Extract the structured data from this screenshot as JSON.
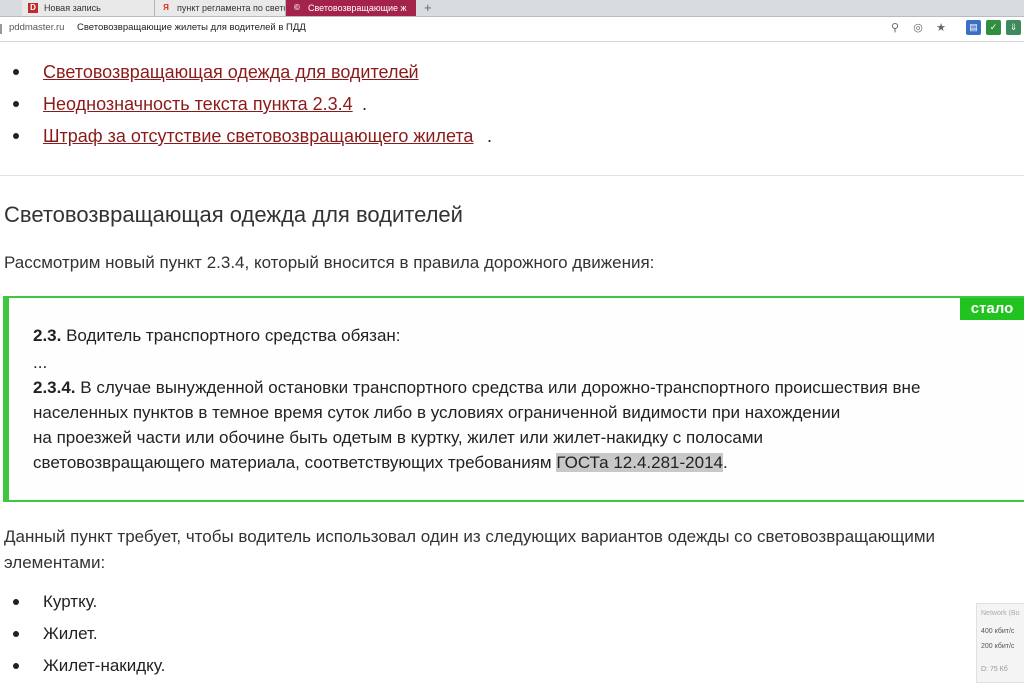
{
  "browser": {
    "tabs": [
      {
        "label": "Новая запись",
        "icon": "D"
      },
      {
        "label": "пункт регламента по свето",
        "icon": "Я"
      },
      {
        "label": "Световозвращающие ж",
        "icon": "©"
      }
    ],
    "new_tab_glyph": "+",
    "domain": "pddmaster.ru",
    "title": "Световозвращающие жилеты для водителей в ПДД"
  },
  "toc": [
    {
      "label": "Световозвращающая одежда для водителей",
      "suffix": "."
    },
    {
      "label": "Неоднозначность текста пункта 2.3.4",
      "suffix": "."
    },
    {
      "label": "Штраф за отсутствие световозвращающего жилета",
      "suffix": "."
    }
  ],
  "section": {
    "heading": "Световозвращающая одежда для водителей",
    "intro": "Рассмотрим новый пункт 2.3.4, который вносится в правила дорожного движения:"
  },
  "quote": {
    "badge": "стало",
    "line1_num": "2.3.",
    "line1_text": " Водитель транспортного средства обязан:",
    "ellipsis": "...",
    "line3_num": "2.3.4.",
    "line3_text": " В случае вынужденной остановки транспортного средства или дорожно-транспортного происшествия вне",
    "line4": "населенных пунктов в темное время суток либо в условиях ограниченной видимости при нахождении",
    "line5": "на проезжей части или обочине быть одетым в куртку, жилет или жилет-накидку с полосами",
    "line6_text": "световозвращающего материала, соответствующих требованиям ",
    "line6_highlight": "ГОСТа 12.4.281-2014",
    "line6_end": "."
  },
  "para2": "Данный пункт требует, чтобы водитель использовал один из следующих вариантов одежды со световозвращающими элементами:",
  "clothing": [
    "Куртку.",
    "Жилет.",
    "Жилет-накидку."
  ],
  "network": {
    "title": "Network (Bo",
    "up": "400 кбит/с",
    "down": "200 кбит/с",
    "footer": "D: 75 Кб"
  },
  "colors": {
    "link": "#8b1a1a",
    "accent_green": "#3ec83e",
    "active_tab": "#a4234b"
  }
}
